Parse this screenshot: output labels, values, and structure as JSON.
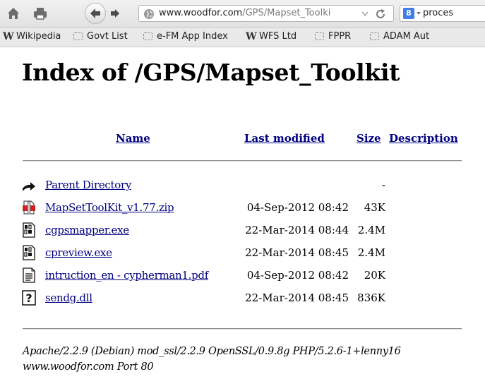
{
  "browser": {
    "url": {
      "host": "www.woodfor.com",
      "path": "/GPS/Mapset_Toolki"
    },
    "search": {
      "engine_label": "8",
      "text": "proces"
    },
    "bookmarks": [
      {
        "label": "Wikipedia",
        "icon": "wikipedia-icon"
      },
      {
        "label": "Govt List",
        "icon": "folder-icon"
      },
      {
        "label": "e-FM App Index",
        "icon": "folder-icon"
      },
      {
        "label": "WFS Ltd",
        "icon": "wikipedia-icon"
      },
      {
        "label": "FPPR",
        "icon": "folder-icon"
      },
      {
        "label": "ADAM Aut",
        "icon": "folder-icon"
      }
    ]
  },
  "page": {
    "title": "Index of /GPS/Mapset_Toolkit",
    "columns": {
      "name": "Name",
      "last_modified": "Last modified",
      "size": "Size",
      "description": "Description"
    },
    "rows": [
      {
        "name": "Parent Directory",
        "date": "",
        "size": "-",
        "icon": "back-arrow-icon"
      },
      {
        "name": "MapSetToolKit_v1.77.zip",
        "date": "04-Sep-2012 08:42",
        "size": "43K",
        "icon": "compressed-file-icon"
      },
      {
        "name": "cgpsmapper.exe",
        "date": "22-Mar-2014 08:44",
        "size": "2.4M",
        "icon": "binary-file-icon"
      },
      {
        "name": "cpreview.exe",
        "date": "22-Mar-2014 08:45",
        "size": "2.4M",
        "icon": "binary-file-icon"
      },
      {
        "name": "intruction_en - cypherman1.pdf",
        "date": "04-Sep-2012 08:42",
        "size": "20K",
        "icon": "text-file-icon"
      },
      {
        "name": "sendg.dll",
        "date": "22-Mar-2014 08:45",
        "size": "836K",
        "icon": "unknown-file-icon"
      }
    ],
    "address": {
      "line1": "Apache/2.2.9 (Debian) mod_ssl/2.2.9 OpenSSL/0.9.8g PHP/5.2.6-1+lenny16",
      "line2": "www.woodfor.com Port 80"
    }
  }
}
